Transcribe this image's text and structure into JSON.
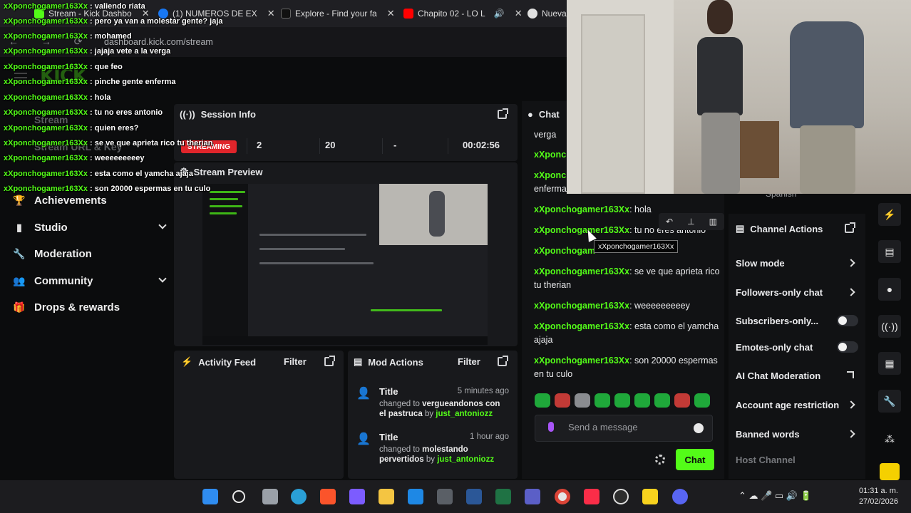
{
  "browser": {
    "tabs": [
      {
        "label": "Stream - Kick Dashbo",
        "color": "#53fc18"
      },
      {
        "label": "(1) NUMEROS DE EX",
        "color": "#1877f2"
      },
      {
        "label": "Explore - Find your fa",
        "color": "#111111"
      },
      {
        "label": "Chapito 02 - LO L",
        "color": "#ff0000"
      },
      {
        "label": "Nueva",
        "color": "#e0e0e0"
      }
    ],
    "url": "dashboard.kick.com/stream"
  },
  "logo": "KICK",
  "sidebar": {
    "ghost_items": [
      "Stream",
      "Stream URL & Key",
      "Achievements"
    ],
    "items": [
      {
        "label": "Achievements",
        "icon": "trophy-icon",
        "chevron": false
      },
      {
        "label": "Studio",
        "icon": "video-icon",
        "chevron": true
      },
      {
        "label": "Moderation",
        "icon": "wrench-icon",
        "chevron": false
      },
      {
        "label": "Community",
        "icon": "people-icon",
        "chevron": true
      },
      {
        "label": "Drops & rewards",
        "icon": "gift-icon",
        "chevron": false
      }
    ]
  },
  "session": {
    "title": "Session Info",
    "status": "STREAMING",
    "viewers": "2",
    "followers": "20",
    "subs": "-",
    "uptime": "00:02:56"
  },
  "preview": {
    "title": "Stream Preview"
  },
  "activity": {
    "title": "Activity Feed",
    "filter": "Filter"
  },
  "mod_actions": {
    "title": "Mod Actions",
    "filter": "Filter",
    "entries": [
      {
        "title": "Title",
        "time": "5 minutes ago",
        "changed": "changed to",
        "value": "vergueandonos con el pastruca",
        "by": "by",
        "user": "just_antoniozz"
      },
      {
        "title": "Title",
        "time": "1 hour ago",
        "changed": "changed to",
        "value": "molestando pervertidos",
        "by": "by",
        "user": "just_antoniozz"
      }
    ]
  },
  "chat": {
    "title": "Chat",
    "messages": [
      {
        "user": "",
        "text": "verga"
      },
      {
        "user": "xXponc",
        "text": ""
      },
      {
        "user": "xXponc",
        "text": ""
      },
      {
        "user": "",
        "text": "enferma"
      },
      {
        "user": "xXponchogamer163Xx",
        "text": ": hola"
      },
      {
        "user": "xXponchogamer163Xx",
        "text": ": tu no eres antonio"
      },
      {
        "user": "xXponchogam",
        "text": ""
      },
      {
        "user": "xXponchogamer163Xx",
        "text": ": se ve que aprieta rico tu therian"
      },
      {
        "user": "xXponchogamer163Xx",
        "text": ": weeeeeeeeey"
      },
      {
        "user": "xXponchogamer163Xx",
        "text": ": esta como el yamcha ajaja"
      },
      {
        "user": "xXponchogamer163Xx",
        "text": ": son 20000 espermas en tu culo"
      }
    ],
    "tooltip": "xXponchogamer163Xx",
    "input_placeholder": "Send a message",
    "send_label": "Chat"
  },
  "channel_actions": {
    "language": "Spanish",
    "title": "Channel Actions",
    "items": [
      {
        "label": "Slow mode",
        "kind": "chevron"
      },
      {
        "label": "Followers-only chat",
        "kind": "chevron"
      },
      {
        "label": "Subscribers-only...",
        "kind": "toggle"
      },
      {
        "label": "Emotes-only chat",
        "kind": "toggle"
      },
      {
        "label": "AI Chat Moderation",
        "kind": "external"
      },
      {
        "label": "Account age restriction",
        "kind": "chevron"
      },
      {
        "label": "Banned words",
        "kind": "chevron"
      },
      {
        "label": "Host Channel",
        "kind": "dim"
      }
    ]
  },
  "overlay_chat": [
    {
      "user": "xXponchogamer163Xx",
      "text": " : valiendo riata"
    },
    {
      "user": "xXponchogamer163Xx",
      "text": " : pero ya van a molestar gente? jaja"
    },
    {
      "user": "xXponchogamer163Xx",
      "text": " : mohamed"
    },
    {
      "user": "xXponchogamer163Xx",
      "text": " : jajaja vete a la verga"
    },
    {
      "user": "xXponchogamer163Xx",
      "text": " : que feo"
    },
    {
      "user": "xXponchogamer163Xx",
      "text": " : pinche gente enferma"
    },
    {
      "user": "xXponchogamer163Xx",
      "text": " : hola"
    },
    {
      "user": "xXponchogamer163Xx",
      "text": " : tu no eres antonio"
    },
    {
      "user": "xXponchogamer163Xx",
      "text": " : quien eres?"
    },
    {
      "user": "xXponchogamer163Xx",
      "text": " : se ve que aprieta rico tu therian"
    },
    {
      "user": "xXponchogamer163Xx",
      "text": " : weeeeeeeeey"
    },
    {
      "user": "xXponchogamer163Xx",
      "text": " : esta como el yamcha ajaja"
    },
    {
      "user": "xXponchogamer163Xx",
      "text": " : son 20000 espermas en tu culo"
    }
  ],
  "taskbar": {
    "time": "01:31 a. m.",
    "date": "27/02/2026",
    "apps": [
      "windows-start-icon",
      "search-icon",
      "file-explorer-icon",
      "edge-icon",
      "brave-icon",
      "copilot-icon",
      "folder-icon",
      "outlook-icon",
      "calculator-icon",
      "word-icon",
      "excel-icon",
      "teams-icon",
      "chrome-icon",
      "music-icon",
      "obs-icon",
      "notes-icon",
      "discord-icon"
    ]
  },
  "colors": {
    "accent": "#53fc18",
    "live": "#e0252b",
    "panel": "#18191c"
  }
}
